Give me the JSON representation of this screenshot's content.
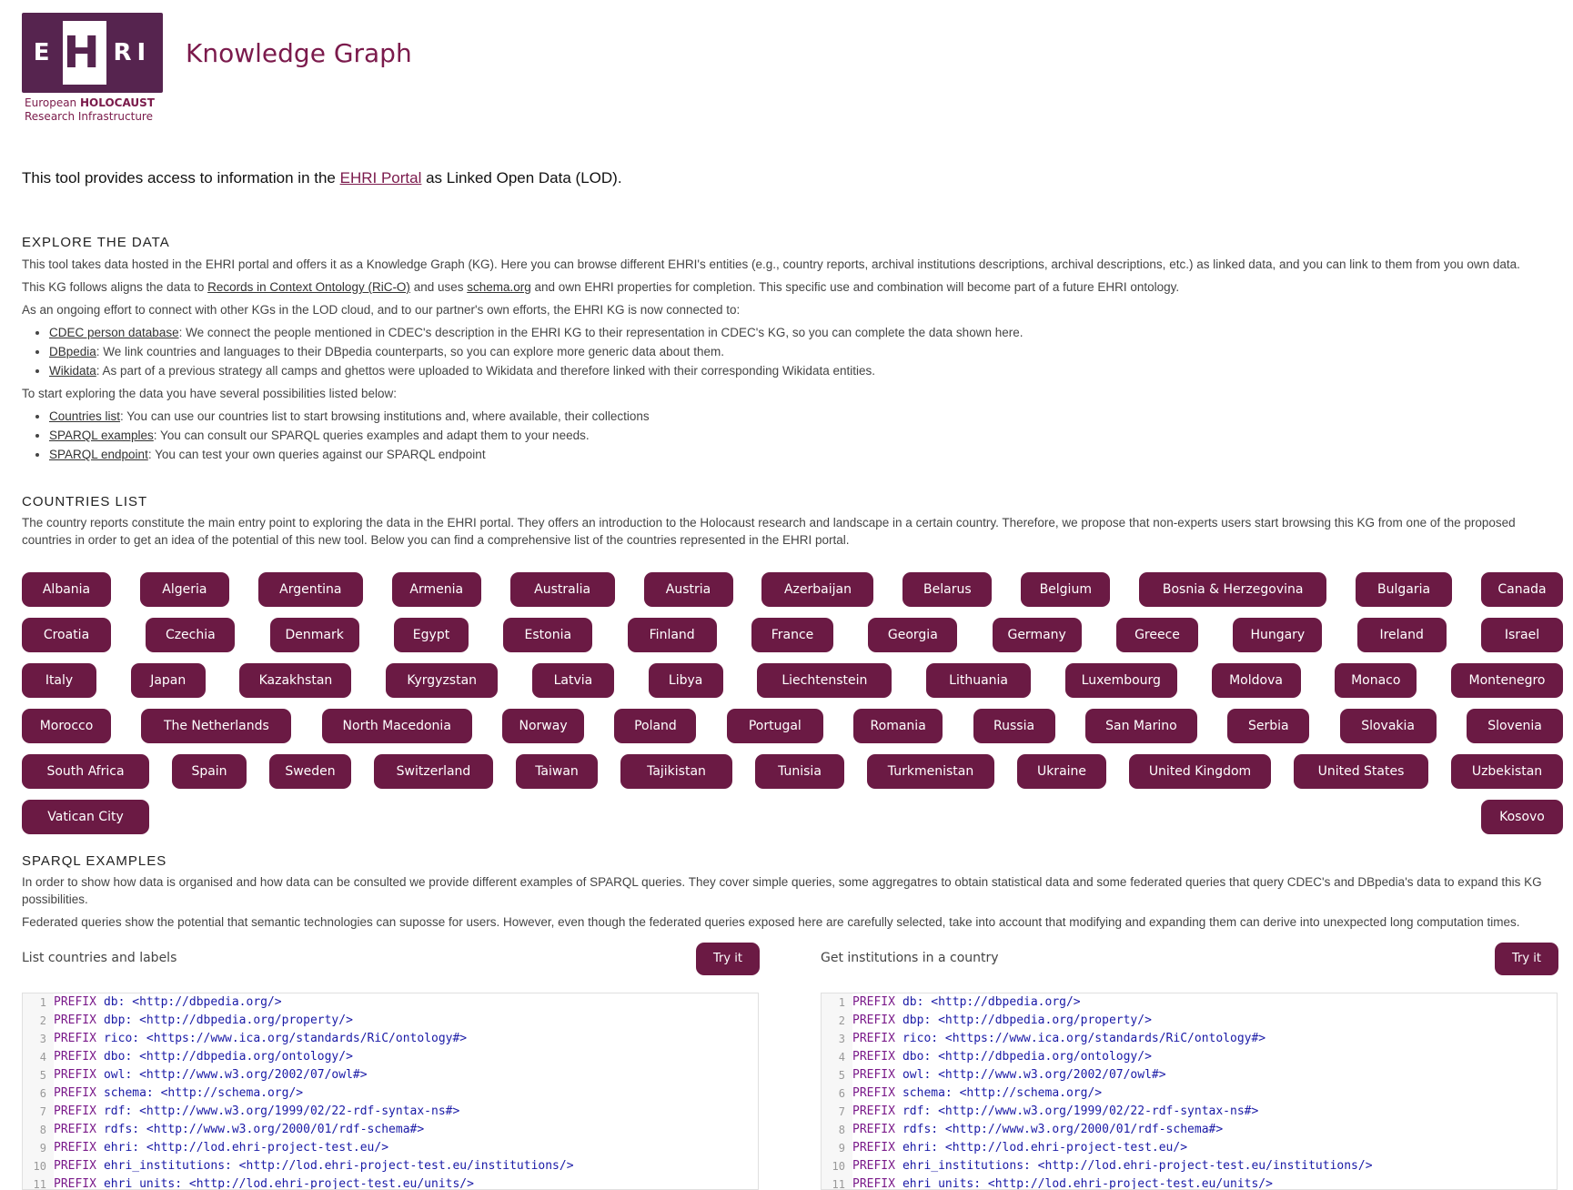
{
  "header": {
    "logo_text_bottom_1": "European",
    "logo_text_bottom_1b": "HOLOCAUST",
    "logo_text_bottom_2": "Research Infrastructure",
    "logo_letters": "EHRI",
    "title": "Knowledge Graph"
  },
  "intro": {
    "before": "This tool provides access to information in the ",
    "link": "EHRI Portal",
    "after": " as Linked Open Data (LOD)."
  },
  "explore": {
    "heading": "EXPLORE THE DATA",
    "p1": "This tool takes data hosted in the EHRI portal and offers it as a Knowledge Graph (KG). Here you can browse different EHRI's entities (e.g., country reports, archival institutions descriptions, archival descriptions, etc.) as linked data, and you can link to them from you own data.",
    "p2_a": "This KG follows aligns the data to ",
    "p2_link1": "Records in Context Ontology (RiC-O)",
    "p2_b": " and uses ",
    "p2_link2": "schema.org",
    "p2_c": " and own EHRI properties for completion. This specific use and combination will become part of a future EHRI ontology.",
    "p3": "As an ongoing effort to connect with other KGs in the LOD cloud, and to our partner's own efforts, the EHRI KG is now connected to:",
    "links": [
      {
        "link": "CDEC person database",
        "text": ": We connect the people mentioned in CDEC's description in the EHRI KG to their representation in CDEC's KG, so you can complete the data shown here."
      },
      {
        "link": "DBpedia",
        "text": ": We link countries and languages to their DBpedia counterparts, so you can explore more generic data about them."
      },
      {
        "link": "Wikidata",
        "text": ": As part of a previous strategy all camps and ghettos were uploaded to Wikidata and therefore linked with their corresponding Wikidata entities."
      }
    ],
    "p4": "To start exploring the data you have several possibilities listed below:",
    "options": [
      {
        "link": "Countries list",
        "text": ": You can use our countries list to start browsing institutions and, where available, their collections"
      },
      {
        "link": "SPARQL examples",
        "text": ": You can consult our SPARQL queries examples and adapt them to your needs."
      },
      {
        "link": "SPARQL endpoint",
        "text": ": You can test your own queries against our SPARQL endpoint"
      }
    ]
  },
  "countries": {
    "heading": "COUNTRIES LIST",
    "desc": "The country reports constitute the main entry point to exploring the data in the EHRI portal. They offers an introduction to the Holocaust research and landscape in a certain country. Therefore, we propose that non-experts users start browsing this KG from one of the proposed countries in order to get an idea of the potential of this new tool. Below you can find a comprehensive list of the countries represented in the EHRI portal.",
    "rows": [
      [
        "Albania",
        "Algeria",
        "Argentina",
        "Armenia",
        "Australia",
        "Austria",
        "Azerbaijan",
        "Belarus",
        "Belgium",
        "Bosnia & Herzegovina",
        "Bulgaria",
        "Canada"
      ],
      [
        "Croatia",
        "Czechia",
        "Denmark",
        "Egypt",
        "Estonia",
        "Finland",
        "France",
        "Georgia",
        "Germany",
        "Greece",
        "Hungary",
        "Ireland",
        "Israel"
      ],
      [
        "Italy",
        "Japan",
        "Kazakhstan",
        "Kyrgyzstan",
        "Latvia",
        "Libya",
        "Liechtenstein",
        "Lithuania",
        "Luxembourg",
        "Moldova",
        "Monaco",
        "Montenegro"
      ],
      [
        "Morocco",
        "The Netherlands",
        "North Macedonia",
        "Norway",
        "Poland",
        "Portugal",
        "Romania",
        "Russia",
        "San Marino",
        "Serbia",
        "Slovakia",
        "Slovenia"
      ],
      [
        "South Africa",
        "Spain",
        "Sweden",
        "Switzerland",
        "Taiwan",
        "Tajikistan",
        "Tunisia",
        "Turkmenistan",
        "Ukraine",
        "United Kingdom",
        "United States",
        "Uzbekistan"
      ],
      [
        "Vatican City",
        "Kosovo"
      ]
    ]
  },
  "sparql": {
    "heading": "SPARQL EXAMPLES",
    "p1": "In order to show how data is organised and how data can be consulted we provide different examples of SPARQL queries. They cover simple queries, some aggregatres to obtain statistical data and some federated queries that query CDEC's and DBpedia's data to expand this KG possibilities.",
    "p2": "Federated queries show the potential that semantic technologies can suposse for users. However, even though the federated queries exposed here are carefully selected, take into account that modifying and expanding them can derive into unexpected long computation times.",
    "try_label": "Try it",
    "queries": [
      {
        "title": "List countries and labels"
      },
      {
        "title": "Get institutions in a country"
      }
    ],
    "code": [
      {
        "n": "1",
        "kw": "PREFIX",
        "rest": "db: <http://dbpedia.org/>"
      },
      {
        "n": "2",
        "kw": "PREFIX",
        "rest": "dbp: <http://dbpedia.org/property/>"
      },
      {
        "n": "3",
        "kw": "PREFIX",
        "rest": "rico: <https://www.ica.org/standards/RiC/ontology#>"
      },
      {
        "n": "4",
        "kw": "PREFIX",
        "rest": "dbo: <http://dbpedia.org/ontology/>"
      },
      {
        "n": "5",
        "kw": "PREFIX",
        "rest": "owl: <http://www.w3.org/2002/07/owl#>"
      },
      {
        "n": "6",
        "kw": "PREFIX",
        "rest": "schema: <http://schema.org/>"
      },
      {
        "n": "7",
        "kw": "PREFIX",
        "rest": "rdf: <http://www.w3.org/1999/02/22-rdf-syntax-ns#>"
      },
      {
        "n": "8",
        "kw": "PREFIX",
        "rest": "rdfs: <http://www.w3.org/2000/01/rdf-schema#>"
      },
      {
        "n": "9",
        "kw": "PREFIX",
        "rest": "ehri:  <http://lod.ehri-project-test.eu/>"
      },
      {
        "n": "10",
        "kw": "PREFIX",
        "rest": "ehri_institutions: <http://lod.ehri-project-test.eu/institutions/>"
      },
      {
        "n": "11",
        "kw": "PREFIX",
        "rest": "ehri_units: <http://lod.ehri-project-test.eu/units/>"
      }
    ]
  }
}
